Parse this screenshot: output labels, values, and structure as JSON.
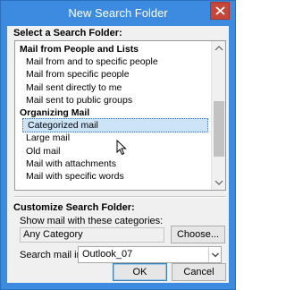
{
  "window": {
    "title": "New Search Folder",
    "close_glyph": "close-icon"
  },
  "select_section": {
    "label": "Select a Search Folder:",
    "items": [
      {
        "type": "header",
        "label": "Mail from People and Lists"
      },
      {
        "type": "item",
        "label": "Mail from and to specific people"
      },
      {
        "type": "item",
        "label": "Mail from specific people"
      },
      {
        "type": "item",
        "label": "Mail sent directly to me"
      },
      {
        "type": "item",
        "label": "Mail sent to public groups"
      },
      {
        "type": "header",
        "label": "Organizing Mail"
      },
      {
        "type": "item",
        "label": "Categorized mail",
        "selected": true
      },
      {
        "type": "item",
        "label": "Large mail"
      },
      {
        "type": "item",
        "label": "Old mail"
      },
      {
        "type": "item",
        "label": "Mail with attachments"
      },
      {
        "type": "item",
        "label": "Mail with specific words"
      }
    ]
  },
  "customize_section": {
    "label": "Customize Search Folder:",
    "categories_label": "Show mail with these categories:",
    "categories_value": "Any Category",
    "choose_button": "Choose...",
    "search_in_label": "Search mail in:",
    "search_in_value": "Outlook_07"
  },
  "buttons": {
    "ok": "OK",
    "cancel": "Cancel"
  },
  "colors": {
    "title_bar": "#3c8be0",
    "close_button": "#c7463a",
    "selection": "#cde3f7"
  }
}
